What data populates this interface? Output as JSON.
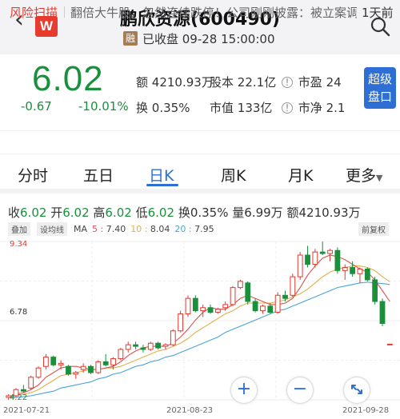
{
  "header": {
    "back_icon": "chevron-left-icon",
    "logo_text": "W",
    "title": "鹏欣资源(600490)",
    "badge": "融",
    "status": "已收盘 09-28 15:00:00",
    "search_icon": "search-icon"
  },
  "quote": {
    "price": "6.02",
    "change": "-0.67",
    "change_pct": "-10.01%",
    "amount_label": "额",
    "amount": "4210.93万",
    "equity_label": "股本",
    "equity": "22.1亿",
    "pe_label": "市盈",
    "pe": "24",
    "turnover_label": "换",
    "turnover": "0.35%",
    "mcap_label": "市值",
    "mcap": "133亿",
    "pb_label": "市净",
    "pb": "2.1",
    "level2_line1": "超级",
    "level2_line2": "盘口"
  },
  "risk": {
    "label": "风险扫描",
    "text": "翻倍大牛股，忽然连续跌停！公司刚刚披露：被立案调",
    "days": "1天前"
  },
  "tabs": [
    {
      "label": "分时"
    },
    {
      "label": "五日"
    },
    {
      "label": "日K"
    },
    {
      "label": "周K"
    },
    {
      "label": "月K"
    },
    {
      "label": "更多"
    }
  ],
  "kline": {
    "close_label": "收",
    "close": "6.02",
    "open_label": "开",
    "open": "6.02",
    "high_label": "高",
    "high": "6.02",
    "low_label": "低",
    "low": "6.02",
    "turn_label": "换",
    "turn": "0.35%",
    "vol_label": "量",
    "vol": "6.99万",
    "amt_label": "额",
    "amt": "4210.93万",
    "overlay_chip": "叠加",
    "ind_chip": "设均线",
    "ma_label": "MA",
    "ma5_label": "5 :",
    "ma5": "7.40",
    "ma10_label": "10 :",
    "ma10": "8.04",
    "ma20_label": "20 :",
    "ma20": "7.95",
    "adjust": "前复权",
    "ymax_label": "9.34",
    "ymid_label": "6.78",
    "ymin_label": "4.22",
    "dates": [
      "2021-07-21",
      "2021-08-23",
      "2021-09-28"
    ],
    "zoom_in": "+",
    "zoom_out": "−",
    "expand_icon": "expand-icon"
  },
  "colors": {
    "up": "#e23a2e",
    "down": "#1a8f3c",
    "accent": "#2e6fd6",
    "ma5": "#d9534f",
    "ma10": "#e0b04a",
    "ma20": "#4aa3d8"
  },
  "chart_data": {
    "type": "candlestick",
    "ylim": [
      4.22,
      9.34
    ],
    "x_start": "2021-07-21",
    "x_end": "2021-09-28",
    "candles": [
      {
        "o": 4.3,
        "h": 4.4,
        "l": 4.22,
        "c": 4.35
      },
      {
        "o": 4.35,
        "h": 4.6,
        "l": 4.3,
        "c": 4.55
      },
      {
        "o": 4.55,
        "h": 4.7,
        "l": 4.45,
        "c": 4.5
      },
      {
        "o": 4.6,
        "h": 5.0,
        "l": 4.55,
        "c": 4.95
      },
      {
        "o": 4.95,
        "h": 5.3,
        "l": 4.9,
        "c": 5.25
      },
      {
        "o": 5.3,
        "h": 5.7,
        "l": 5.2,
        "c": 5.6
      },
      {
        "o": 5.6,
        "h": 5.65,
        "l": 5.3,
        "c": 5.35
      },
      {
        "o": 5.35,
        "h": 5.5,
        "l": 5.2,
        "c": 5.4
      },
      {
        "o": 5.3,
        "h": 5.35,
        "l": 5.0,
        "c": 5.05
      },
      {
        "o": 5.05,
        "h": 5.15,
        "l": 4.9,
        "c": 5.1
      },
      {
        "o": 5.2,
        "h": 5.4,
        "l": 5.1,
        "c": 5.3
      },
      {
        "o": 5.3,
        "h": 5.35,
        "l": 5.05,
        "c": 5.1
      },
      {
        "o": 5.1,
        "h": 5.5,
        "l": 5.05,
        "c": 5.45
      },
      {
        "o": 5.45,
        "h": 5.7,
        "l": 5.3,
        "c": 5.35
      },
      {
        "o": 5.35,
        "h": 5.6,
        "l": 5.2,
        "c": 5.55
      },
      {
        "o": 5.55,
        "h": 5.9,
        "l": 5.5,
        "c": 5.85
      },
      {
        "o": 5.85,
        "h": 6.1,
        "l": 5.75,
        "c": 6.0
      },
      {
        "o": 6.0,
        "h": 6.1,
        "l": 5.85,
        "c": 5.95
      },
      {
        "o": 5.9,
        "h": 6.0,
        "l": 5.75,
        "c": 5.85
      },
      {
        "o": 5.85,
        "h": 6.1,
        "l": 5.8,
        "c": 6.05
      },
      {
        "o": 6.05,
        "h": 6.1,
        "l": 5.85,
        "c": 5.9
      },
      {
        "o": 5.95,
        "h": 6.05,
        "l": 5.85,
        "c": 6.0
      },
      {
        "o": 6.0,
        "h": 6.5,
        "l": 5.95,
        "c": 6.45
      },
      {
        "o": 6.45,
        "h": 7.1,
        "l": 6.4,
        "c": 7.0
      },
      {
        "o": 7.0,
        "h": 7.6,
        "l": 6.9,
        "c": 7.5
      },
      {
        "o": 7.5,
        "h": 7.6,
        "l": 7.05,
        "c": 7.1
      },
      {
        "o": 7.1,
        "h": 7.3,
        "l": 6.9,
        "c": 7.2
      },
      {
        "o": 7.2,
        "h": 7.3,
        "l": 7.0,
        "c": 7.05
      },
      {
        "o": 7.05,
        "h": 7.2,
        "l": 7.0,
        "c": 7.15
      },
      {
        "o": 7.2,
        "h": 7.4,
        "l": 7.1,
        "c": 7.3
      },
      {
        "o": 7.3,
        "h": 7.9,
        "l": 7.25,
        "c": 7.85
      },
      {
        "o": 7.85,
        "h": 8.1,
        "l": 7.8,
        "c": 8.05
      },
      {
        "o": 8.0,
        "h": 8.05,
        "l": 7.3,
        "c": 7.4
      },
      {
        "o": 7.4,
        "h": 7.5,
        "l": 7.05,
        "c": 7.1
      },
      {
        "o": 7.1,
        "h": 7.3,
        "l": 7.0,
        "c": 7.25
      },
      {
        "o": 7.25,
        "h": 7.35,
        "l": 7.0,
        "c": 7.05
      },
      {
        "o": 7.05,
        "h": 7.7,
        "l": 7.0,
        "c": 7.6
      },
      {
        "o": 7.6,
        "h": 7.75,
        "l": 7.4,
        "c": 7.5
      },
      {
        "o": 7.6,
        "h": 8.3,
        "l": 7.55,
        "c": 8.2
      },
      {
        "o": 8.2,
        "h": 9.0,
        "l": 8.1,
        "c": 8.9
      },
      {
        "o": 8.9,
        "h": 9.2,
        "l": 8.5,
        "c": 8.6
      },
      {
        "o": 8.6,
        "h": 9.1,
        "l": 8.5,
        "c": 9.0
      },
      {
        "o": 9.0,
        "h": 9.34,
        "l": 8.9,
        "c": 8.95
      },
      {
        "o": 8.95,
        "h": 9.1,
        "l": 8.7,
        "c": 9.05
      },
      {
        "o": 9.05,
        "h": 9.15,
        "l": 8.3,
        "c": 8.4
      },
      {
        "o": 8.4,
        "h": 8.6,
        "l": 8.1,
        "c": 8.5
      },
      {
        "o": 8.5,
        "h": 8.7,
        "l": 8.2,
        "c": 8.3
      },
      {
        "o": 8.3,
        "h": 8.5,
        "l": 8.0,
        "c": 8.45
      },
      {
        "o": 8.45,
        "h": 8.5,
        "l": 8.05,
        "c": 8.1
      },
      {
        "o": 8.1,
        "h": 8.2,
        "l": 7.3,
        "c": 7.4
      },
      {
        "o": 7.4,
        "h": 7.5,
        "l": 6.6,
        "c": 6.69
      },
      {
        "o": 6.02,
        "h": 6.02,
        "l": 6.02,
        "c": 6.02
      }
    ],
    "ma5": [
      4.3,
      4.4,
      4.45,
      4.55,
      4.7,
      4.95,
      5.1,
      5.25,
      5.3,
      5.3,
      5.25,
      5.2,
      5.2,
      5.25,
      5.3,
      5.45,
      5.65,
      5.8,
      5.9,
      5.95,
      5.95,
      5.95,
      6.05,
      6.25,
      6.5,
      6.8,
      7.05,
      7.2,
      7.15,
      7.15,
      7.3,
      7.5,
      7.6,
      7.5,
      7.4,
      7.3,
      7.3,
      7.35,
      7.5,
      7.85,
      8.25,
      8.55,
      8.8,
      8.9,
      8.85,
      8.75,
      8.6,
      8.45,
      8.35,
      8.1,
      7.75,
      7.4
    ],
    "ma10": [
      4.3,
      4.35,
      4.4,
      4.45,
      4.55,
      4.7,
      4.85,
      5.0,
      5.05,
      5.1,
      5.15,
      5.2,
      5.2,
      5.25,
      5.25,
      5.3,
      5.4,
      5.5,
      5.6,
      5.7,
      5.8,
      5.85,
      5.95,
      6.05,
      6.2,
      6.4,
      6.55,
      6.7,
      6.85,
      7.0,
      7.1,
      7.25,
      7.35,
      7.35,
      7.35,
      7.35,
      7.4,
      7.45,
      7.55,
      7.65,
      7.8,
      8.0,
      8.2,
      8.35,
      8.45,
      8.5,
      8.55,
      8.55,
      8.5,
      8.4,
      8.2,
      8.04
    ],
    "ma20": [
      4.3,
      4.3,
      4.32,
      4.35,
      4.4,
      4.45,
      4.5,
      4.6,
      4.65,
      4.7,
      4.75,
      4.8,
      4.9,
      4.95,
      5.05,
      5.1,
      5.2,
      5.3,
      5.35,
      5.45,
      5.5,
      5.6,
      5.65,
      5.75,
      5.85,
      5.95,
      6.05,
      6.15,
      6.25,
      6.4,
      6.5,
      6.6,
      6.7,
      6.8,
      6.9,
      7.0,
      7.1,
      7.15,
      7.25,
      7.35,
      7.45,
      7.55,
      7.65,
      7.75,
      7.85,
      7.9,
      7.95,
      8.0,
      8.02,
      8.0,
      7.98,
      7.95
    ]
  }
}
